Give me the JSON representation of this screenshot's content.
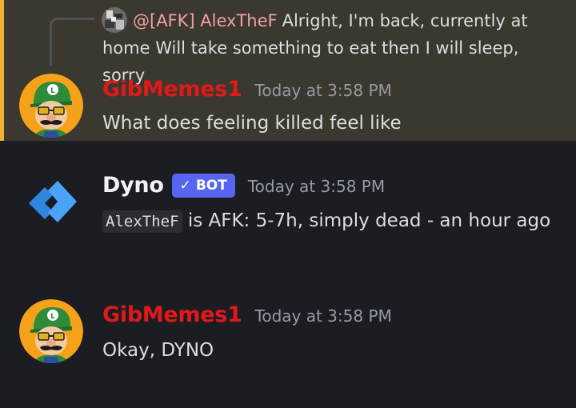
{
  "reply": {
    "author": "@[AFK] AlexTheF",
    "text": "Alright, I'm back, currently at home Will take something to eat then I will sleep, sorry"
  },
  "messages": [
    {
      "username": "GibMemes1",
      "timestamp": "Today at 3:58 PM",
      "content": "What does feeling killed feel like"
    },
    {
      "username": "Dyno",
      "bot_tag": "BOT",
      "timestamp": "Today at 3:58 PM",
      "code_user": "AlexTheF",
      "content": " is AFK: 5-7h, simply dead - an hour ago"
    },
    {
      "username": "GibMemes1",
      "timestamp": "Today at 3:58 PM",
      "content": "Okay, DYNO"
    }
  ],
  "colors": {
    "mention_highlight": "#3b382f",
    "mention_bar": "#f0b232",
    "username_red": "#e01919",
    "bot_tag": "#5865f2",
    "background": "#1c1d22"
  }
}
